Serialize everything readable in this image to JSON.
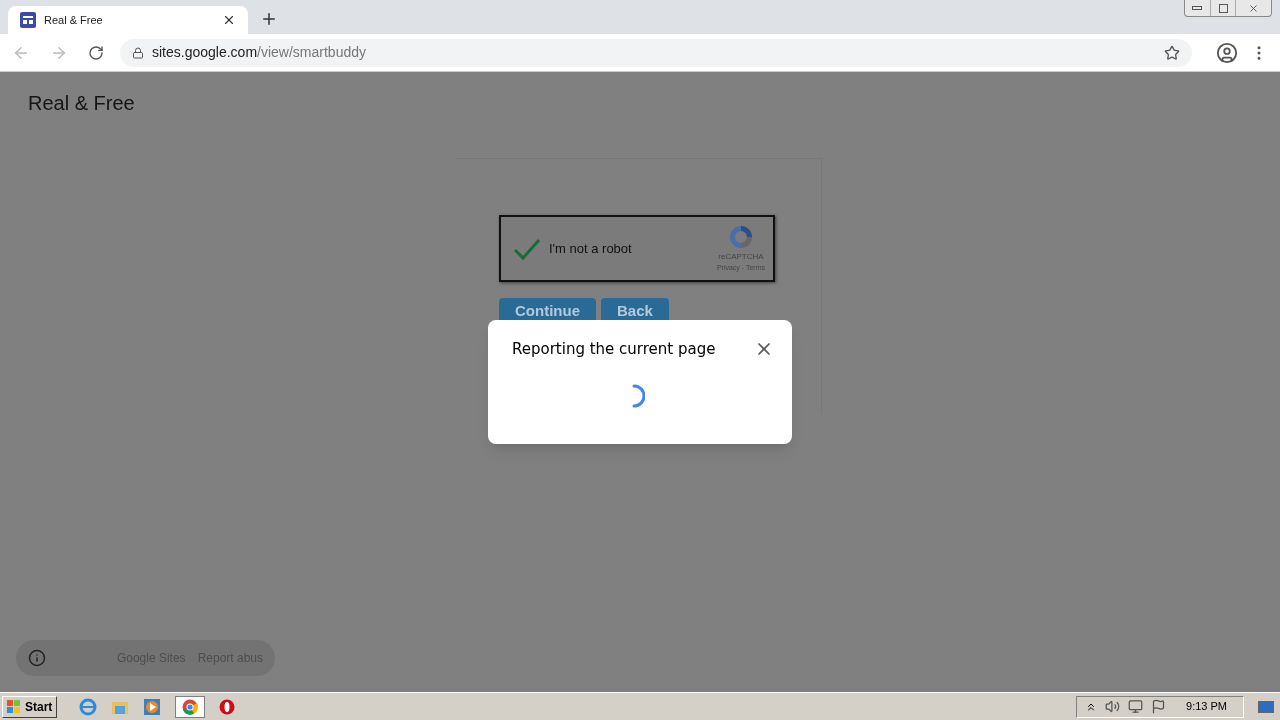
{
  "browser": {
    "tab_title": "Real & Free",
    "url_host": "sites.google.com",
    "url_path": "/view/smartbuddy"
  },
  "page": {
    "site_title": "Real & Free",
    "captcha": {
      "checked": true,
      "label": "I'm not a robot",
      "brand": "reCAPTCHA",
      "links": "Privacy - Terms"
    },
    "buttons": [
      "Continue",
      "Back"
    ],
    "footer": [
      "Google Sites",
      "Report abus"
    ]
  },
  "dialog": {
    "title": "Reporting the current page",
    "loading": true
  },
  "taskbar": {
    "start": "Start",
    "clock": "9:13 PM"
  }
}
